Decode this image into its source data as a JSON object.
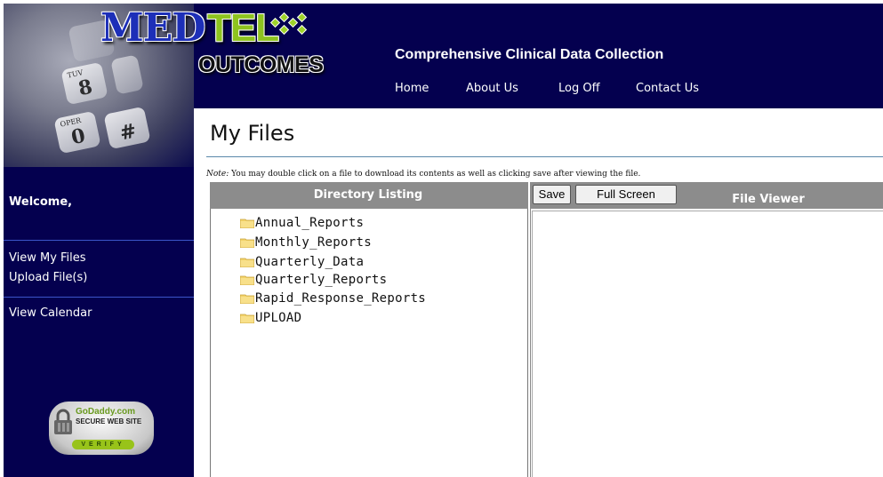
{
  "header": {
    "logo": {
      "line1a": "MED",
      "line1b": "TEL",
      "line2": "OUTCOMES"
    },
    "tagline": "Comprehensive Clinical Data Collection",
    "nav": [
      "Home",
      "About Us",
      "Log Off",
      "Contact Us"
    ]
  },
  "phone_keys": [
    {
      "digit": "8",
      "letters": "TUV"
    },
    {
      "digit": "0",
      "letters": "OPER"
    },
    {
      "digit": "#",
      "letters": ""
    }
  ],
  "sidebar": {
    "welcome": "Welcome,",
    "links": [
      "View My Files",
      "Upload File(s)",
      "View Calendar"
    ],
    "badge": {
      "line1": "GoDaddy.com",
      "line2": "SECURE WEB SITE",
      "verify": "VERIFY"
    }
  },
  "main": {
    "title": "My Files",
    "note_prefix": "Note:",
    "note_text": " You may double click on a file to download its contents as well as clicking save after viewing the file.",
    "directory_header": "Directory Listing",
    "viewer_header": "File Viewer",
    "buttons": {
      "save": "Save",
      "full_screen": "Full Screen"
    },
    "folders": [
      "Annual_Reports",
      "Monthly_Reports",
      "Quarterly_Data",
      "Quarterly_Reports",
      "Rapid_Response_Reports",
      "UPLOAD"
    ]
  },
  "colors": {
    "navy": "#04004f",
    "header_bar_gray": "#8c8c8c",
    "logo_blue": "#1d2fb8",
    "logo_green": "#8ec31f",
    "folder_yellow": "#f2d36a"
  },
  "icons": [
    "phone-keypad-image",
    "folder-icon",
    "padlock-icon"
  ]
}
